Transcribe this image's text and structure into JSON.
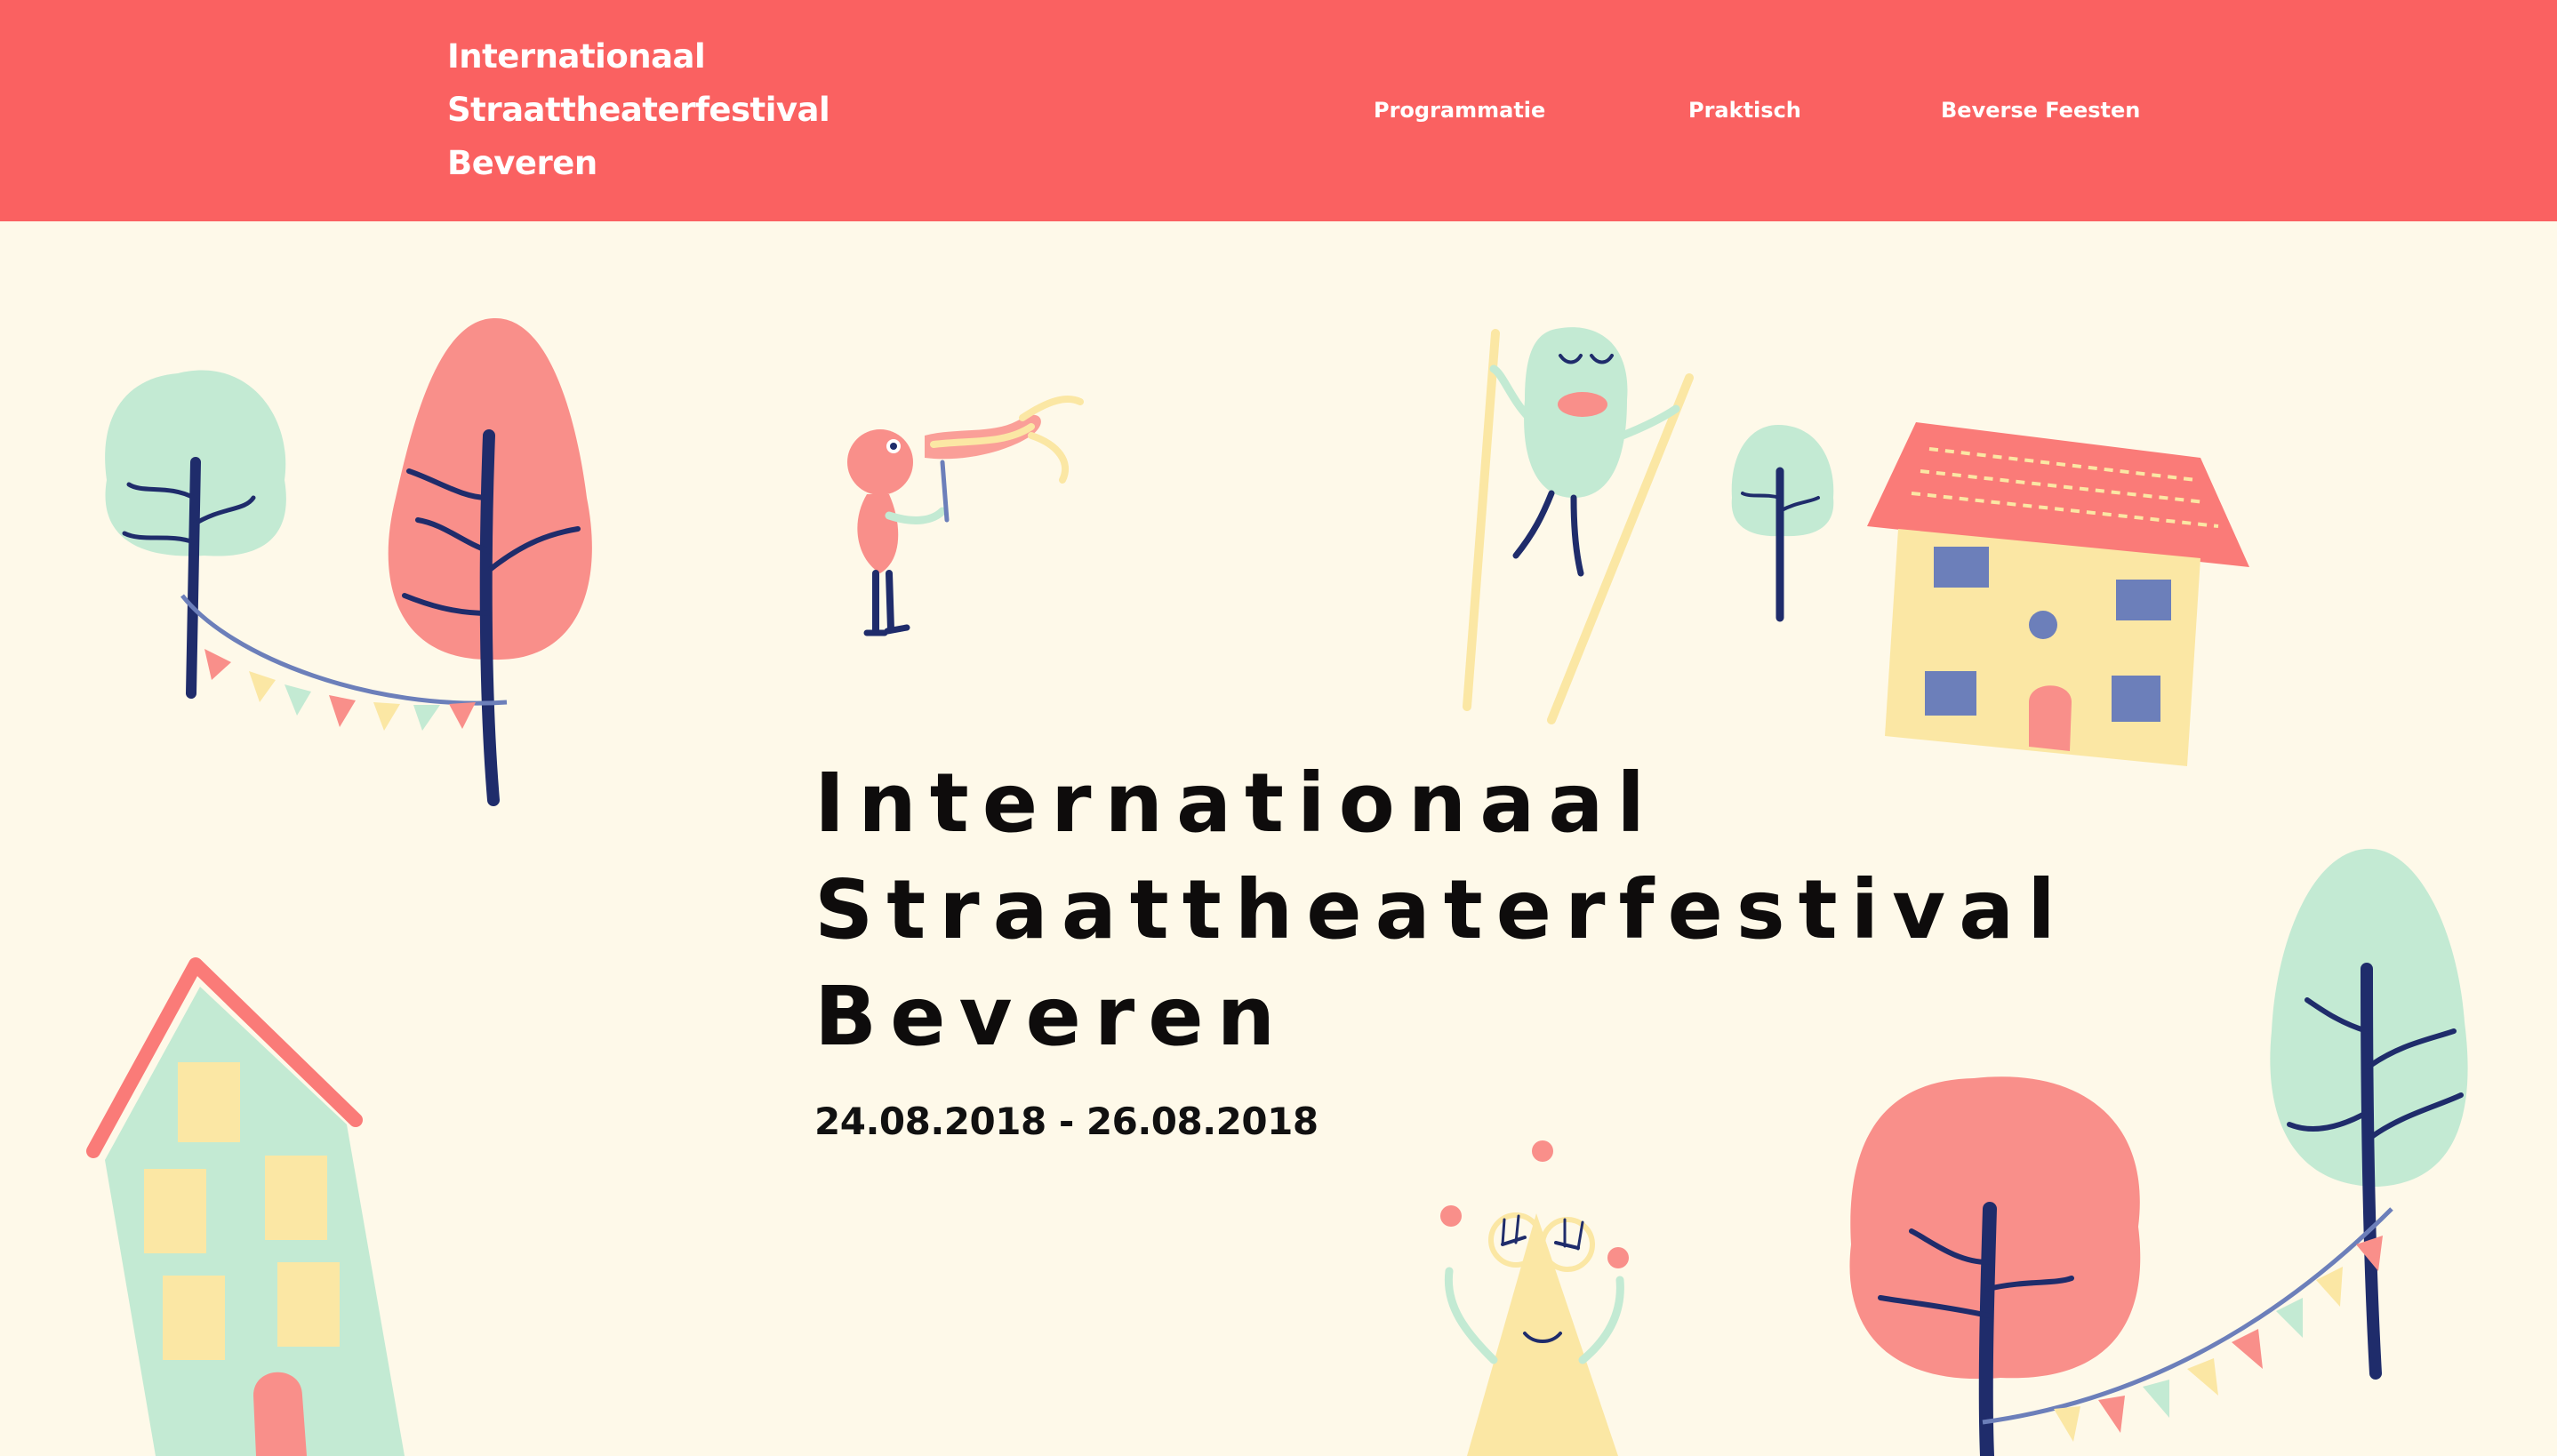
{
  "header": {
    "logo_lines": [
      "Internationaal",
      "Straattheaterfestival",
      "Beveren"
    ],
    "nav": [
      {
        "label": "Programmatie"
      },
      {
        "label": "Praktisch"
      },
      {
        "label": "Beverse Feesten"
      }
    ]
  },
  "hero": {
    "title_lines": [
      "Internationaal",
      "Straattheaterfestival",
      "Beveren"
    ],
    "dates": "24.08.2018 - 26.08.2018"
  },
  "colors": {
    "header_bg": "#fa6161",
    "page_bg": "#fef9e9",
    "mint": "#c3ead3",
    "pink": "#f98f8a",
    "yellow": "#fbe7a4",
    "navy": "#1f2c6b"
  },
  "illustrations": [
    "tree-icon",
    "bunting-icon",
    "trumpeter-icon",
    "stilt-walker-icon",
    "house-icon",
    "juggler-icon"
  ]
}
